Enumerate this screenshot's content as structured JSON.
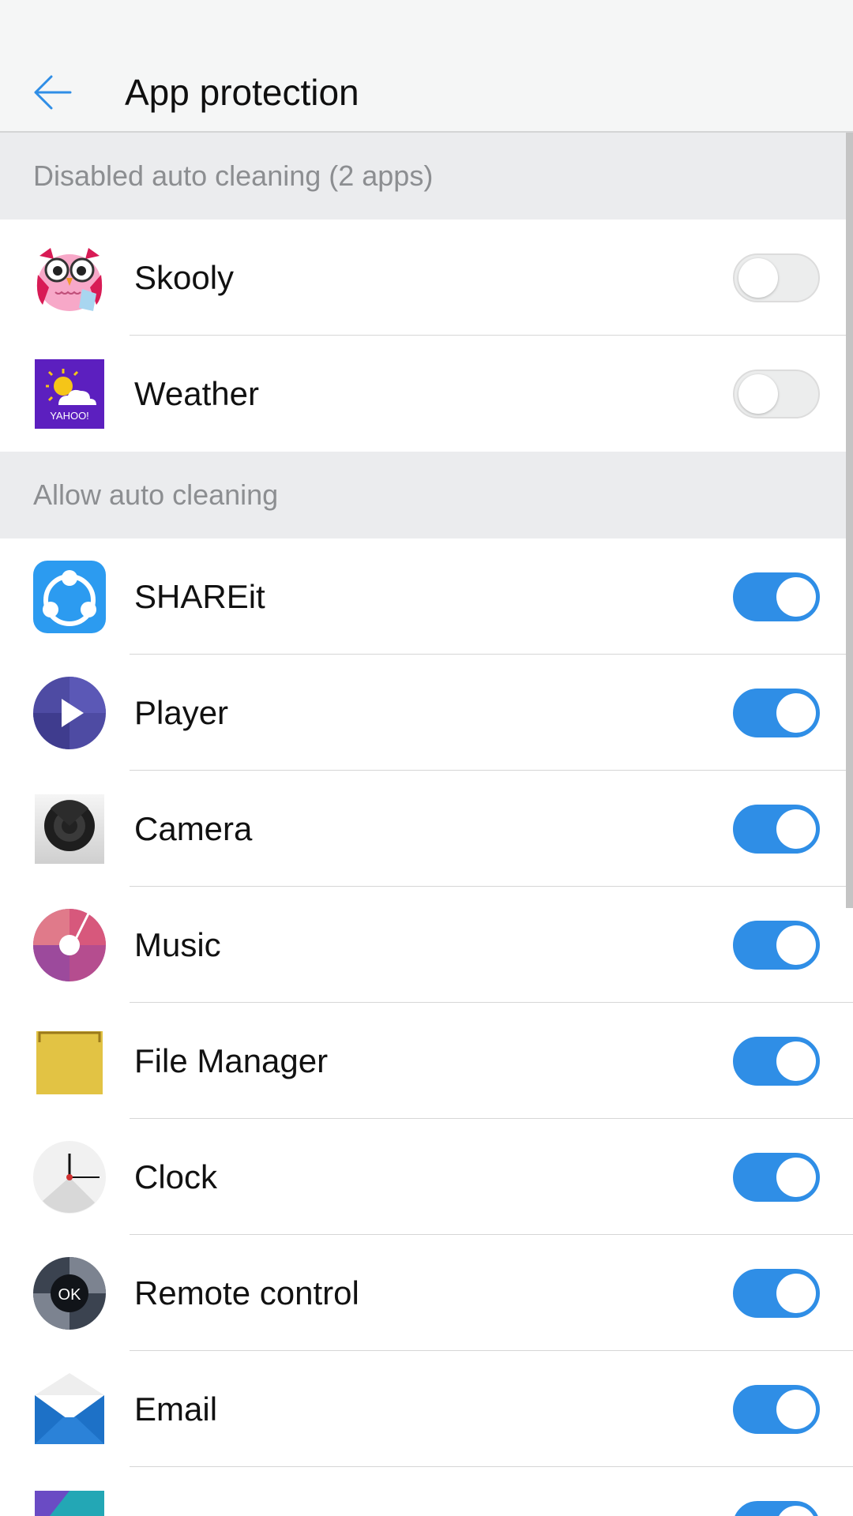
{
  "header": {
    "title": "App protection"
  },
  "sections": [
    {
      "title": "Disabled auto cleaning (2 apps)",
      "apps": [
        {
          "name": "Skooly",
          "icon": "skooly-owl-icon",
          "enabled": false
        },
        {
          "name": "Weather",
          "icon": "yahoo-weather-icon",
          "enabled": false
        }
      ]
    },
    {
      "title": "Allow auto cleaning",
      "apps": [
        {
          "name": "SHAREit",
          "icon": "shareit-icon",
          "enabled": true
        },
        {
          "name": "Player",
          "icon": "player-icon",
          "enabled": true
        },
        {
          "name": "Camera",
          "icon": "camera-icon",
          "enabled": true
        },
        {
          "name": "Music",
          "icon": "music-icon",
          "enabled": true
        },
        {
          "name": "File Manager",
          "icon": "file-manager-icon",
          "enabled": true
        },
        {
          "name": "Clock",
          "icon": "clock-icon",
          "enabled": true
        },
        {
          "name": "Remote control",
          "icon": "remote-control-icon",
          "enabled": true
        },
        {
          "name": "Email",
          "icon": "email-icon",
          "enabled": true
        }
      ]
    }
  ],
  "colors": {
    "accent": "#2f8ee6",
    "section_bg": "#ebecee",
    "section_text": "#8c8e91"
  },
  "icons": {
    "back": "arrow-left-icon"
  }
}
